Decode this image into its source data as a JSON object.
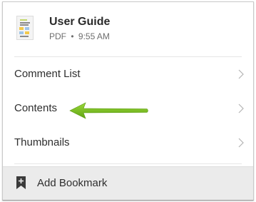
{
  "document": {
    "title": "User Guide",
    "type": "PDF",
    "separator": "•",
    "time": "9:55 AM",
    "thumbnail_icon": "pdf-thumbnail-icon"
  },
  "menu": {
    "items": [
      {
        "label": "Comment List",
        "icon": "chevron-right-icon"
      },
      {
        "label": "Contents",
        "icon": "chevron-right-icon"
      },
      {
        "label": "Thumbnails",
        "icon": "chevron-right-icon"
      }
    ]
  },
  "footer": {
    "label": "Add Bookmark",
    "icon": "bookmark-add-icon"
  },
  "annotation": {
    "icon": "arrow-left-icon",
    "color": "#7cc520"
  },
  "colors": {
    "text": "#2e2e2e",
    "muted": "#6e6e6e",
    "footer_bg": "#ebebeb",
    "chevron": "#b3b3b3"
  }
}
